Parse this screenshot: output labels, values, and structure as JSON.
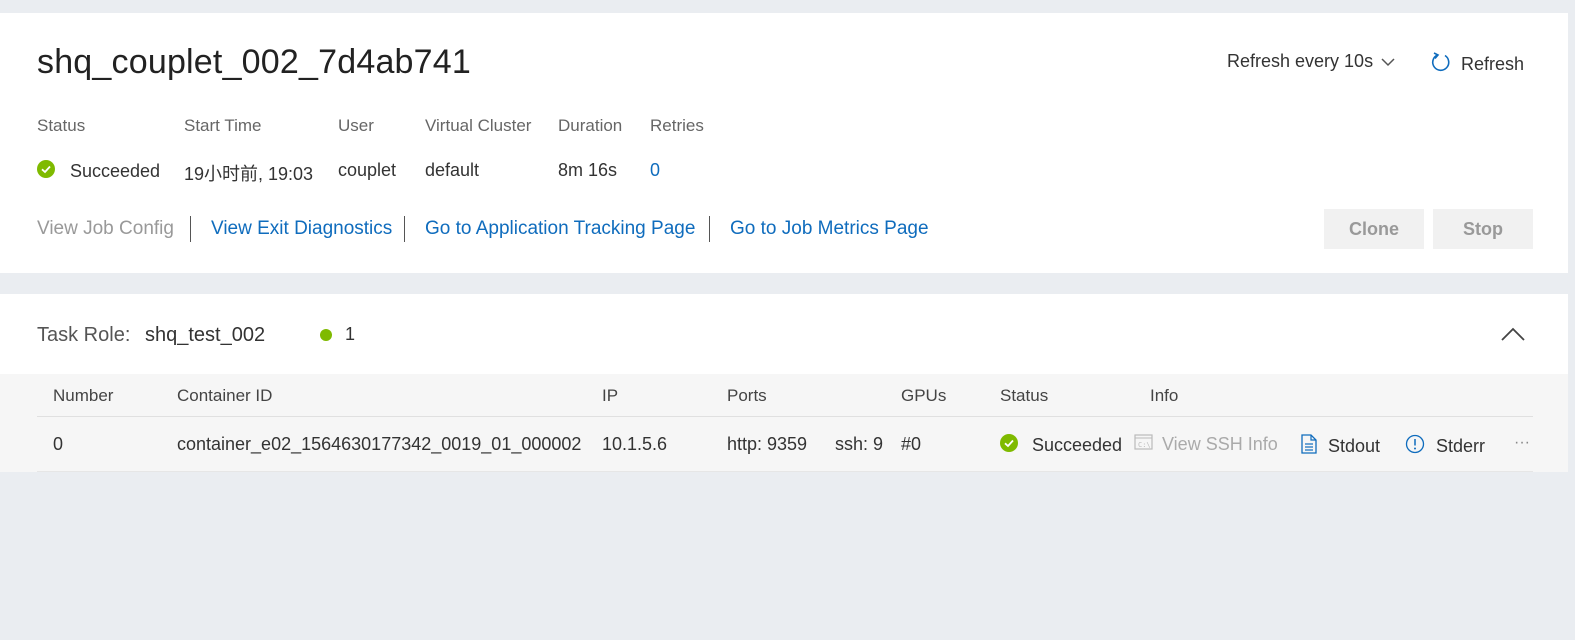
{
  "job": {
    "title": "shq_couplet_002_7d4ab741",
    "refresh_interval": "Refresh every 10s",
    "refresh_label": "Refresh",
    "labels": {
      "status": "Status",
      "start_time": "Start Time",
      "user": "User",
      "virtual_cluster": "Virtual Cluster",
      "duration": "Duration",
      "retries": "Retries"
    },
    "values": {
      "status": "Succeeded",
      "start_time": "19小时前, 19:03",
      "user": "couplet",
      "virtual_cluster": "default",
      "duration": "8m 16s",
      "retries": "0"
    },
    "links": {
      "view_job_config": "View Job Config",
      "view_exit_diagnostics": "View Exit Diagnostics",
      "app_tracking": "Go to Application Tracking Page",
      "job_metrics": "Go to Job Metrics Page"
    },
    "buttons": {
      "clone": "Clone",
      "stop": "Stop"
    }
  },
  "task_role": {
    "label": "Task Role:",
    "name": "shq_test_002",
    "count": "1",
    "columns": {
      "number": "Number",
      "container_id": "Container ID",
      "ip": "IP",
      "ports": "Ports",
      "gpus": "GPUs",
      "status": "Status",
      "info": "Info"
    },
    "rows": [
      {
        "number": "0",
        "container_id": "container_e02_1564630177342_0019_01_000002",
        "ip": "10.1.5.6",
        "port_http": "http:  9359",
        "port_ssh": "ssh:  9",
        "gpus": "#0",
        "status": "Succeeded",
        "ssh_info": "View SSH Info",
        "stdout": "Stdout",
        "stderr": "Stderr",
        "more": "···"
      }
    ]
  },
  "colors": {
    "success": "#7fba00",
    "link": "#0f6cbd",
    "disabled": "#999999",
    "page_bg": "#eaedf1"
  },
  "icons": [
    "check-circle-icon",
    "chevron-down-icon",
    "refresh-icon",
    "chevron-up-icon",
    "terminal-icon",
    "document-icon",
    "info-circle-icon",
    "more-icon"
  ]
}
